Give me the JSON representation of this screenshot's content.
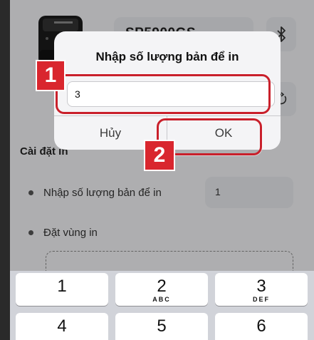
{
  "printer": {
    "model_name": "SP5900GS"
  },
  "settings": {
    "section_title": "Cài đặt in",
    "copies_label": "Nhập số lượng bản để in",
    "copies_value": "1",
    "area_label": "Đặt vùng in"
  },
  "dialog": {
    "title": "Nhập số lượng bản để in",
    "input_value": "3",
    "cancel_label": "Hủy",
    "ok_label": "OK"
  },
  "annotations": {
    "badge_1": "1",
    "badge_2": "2",
    "highlight_color": "#d9262e"
  },
  "keyboard": {
    "keys": [
      {
        "num": "1",
        "letters": ""
      },
      {
        "num": "2",
        "letters": "ABC"
      },
      {
        "num": "3",
        "letters": "DEF"
      },
      {
        "num": "4",
        "letters": ""
      },
      {
        "num": "5",
        "letters": ""
      },
      {
        "num": "6",
        "letters": ""
      }
    ]
  }
}
